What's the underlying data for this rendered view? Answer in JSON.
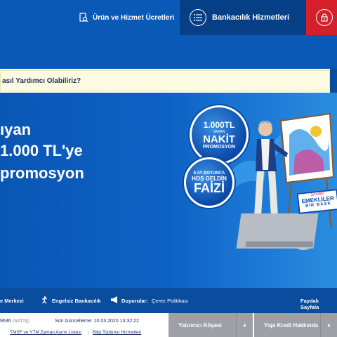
{
  "header": {
    "fees_label": "Ürün ve Hizmet Ücretleri",
    "banking_label": "Bankacılık Hizmetleri"
  },
  "search": {
    "placeholder": "asıl Yardımcı Olabiliriz?"
  },
  "hero": {
    "line1": "ıyan",
    "line2": "1.000 TL'ye",
    "line3": "promosyon",
    "badge1": {
      "amount": "1.000TL",
      "sub": "VARAN",
      "big": "NAKİT",
      "small": "PROMOSYON"
    },
    "badge2": {
      "top": "6 AY BOYUNCA",
      "mid": "HOŞ GELDİN",
      "big": "FAİZİ"
    },
    "sign": {
      "line1": "Şimdiki",
      "line2": "EMEKLİLER",
      "line3": "BİR BASK"
    }
  },
  "footer": {
    "items": [
      "e Merkezi",
      "Engelsiz Bankacılık",
      "Duyurular:",
      "Çerez Politikası",
      "Faydalı Sayfala"
    ]
  },
  "bottom": {
    "rate_value": "9636",
    "rate_label": "(SATIŞ)",
    "updated": "Son Güncelleme: 10.03.2020 13:32:22",
    "link1": "TMSF ve YTM Zaman Aşımı Listesi",
    "separator": "|",
    "link2": "Bilgi Toplumu Hizmetleri",
    "tab1": "Yatırımcı Köşesi",
    "tab2": "Yapı Kredi Hakkında",
    "arrow": "▲"
  }
}
